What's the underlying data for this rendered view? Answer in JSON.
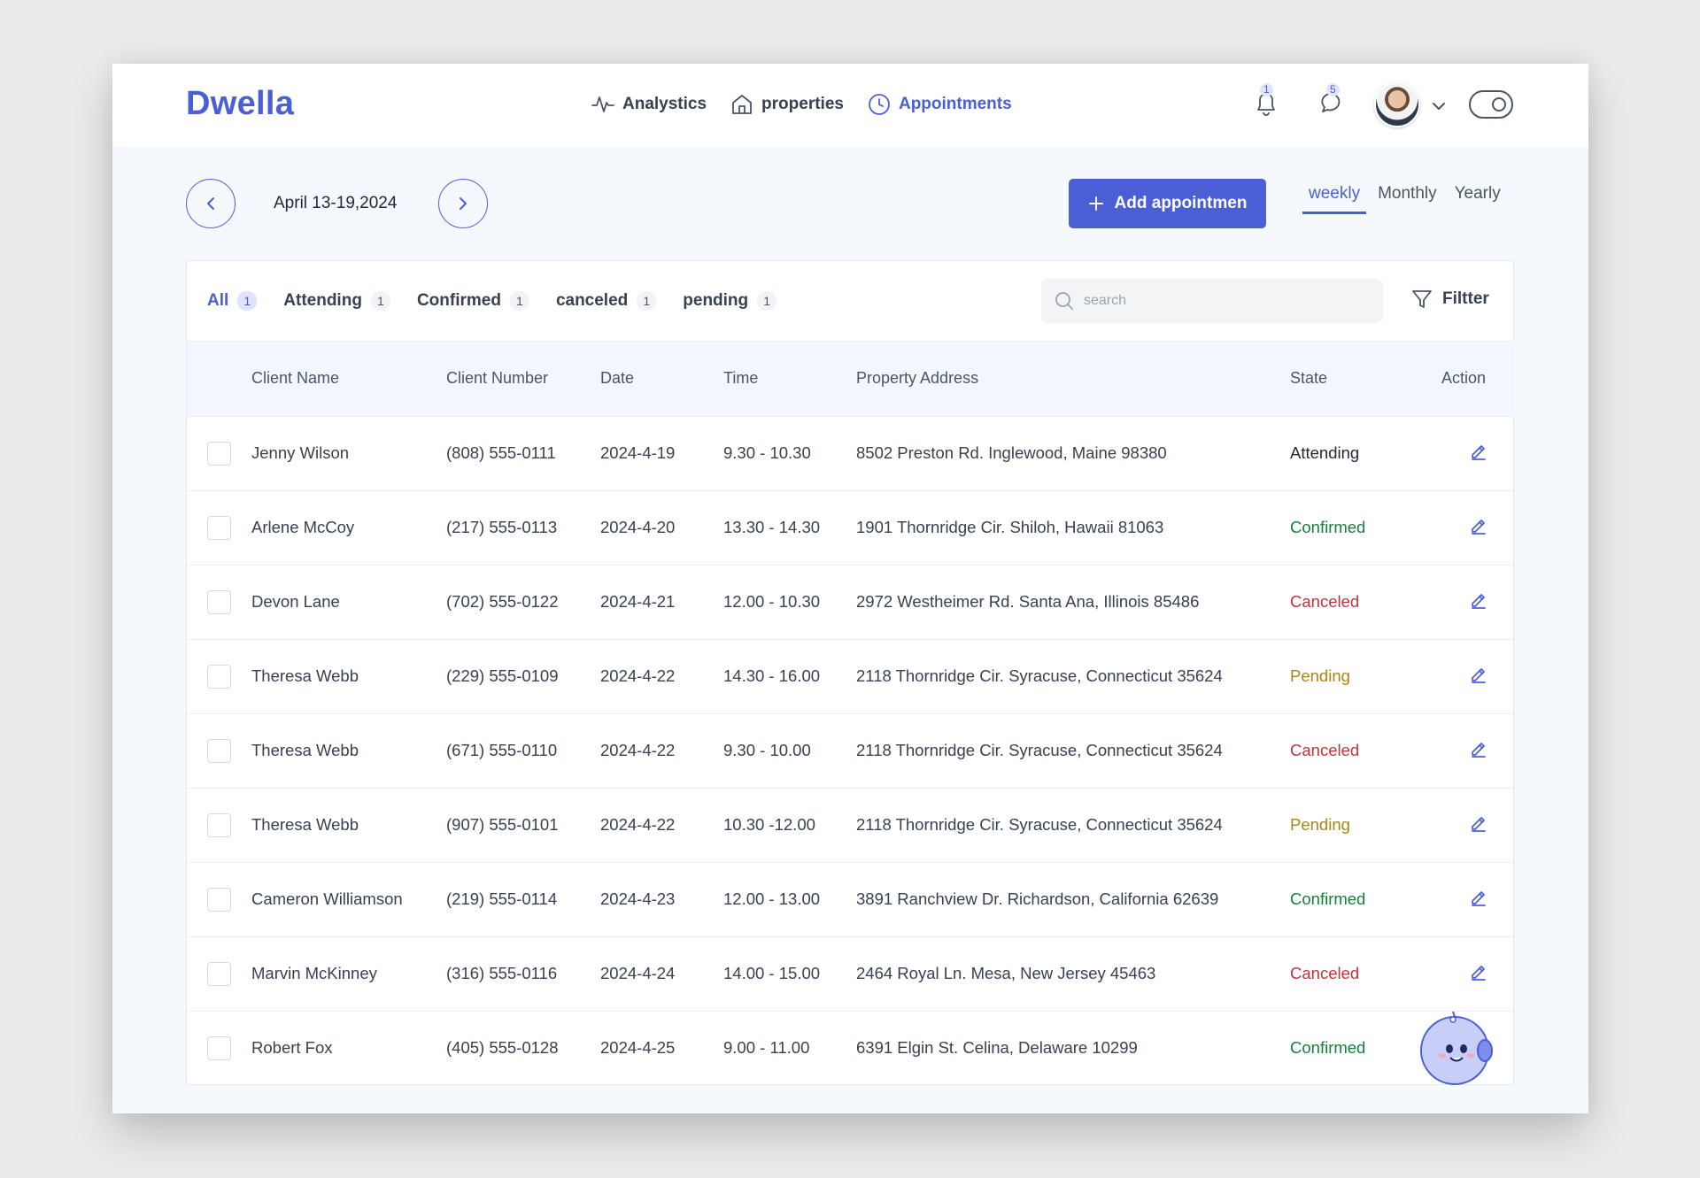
{
  "app": {
    "logo": "Dwella"
  },
  "nav": [
    {
      "label": "Analystics",
      "icon": "analytics-icon",
      "active": false
    },
    {
      "label": "properties",
      "icon": "home-icon",
      "active": false
    },
    {
      "label": "Appointments",
      "icon": "clock-icon",
      "active": true
    }
  ],
  "header": {
    "notifications_count": "1",
    "messages_count": "5",
    "accent_color": "#4a5fd6"
  },
  "toolbar": {
    "date_range": "April 13-19,2024",
    "add_button_label": "Add appointmen",
    "period_tabs": [
      {
        "label": "weekly",
        "active": true
      },
      {
        "label": "Monthly",
        "active": false
      },
      {
        "label": "Yearly",
        "active": false
      }
    ]
  },
  "filters": {
    "tabs": [
      {
        "label": "All",
        "count": "1",
        "active": true
      },
      {
        "label": "Attending",
        "count": "1",
        "active": false
      },
      {
        "label": "Confirmed",
        "count": "1",
        "active": false
      },
      {
        "label": "canceled",
        "count": "1",
        "active": false
      },
      {
        "label": "pending",
        "count": "1",
        "active": false
      }
    ],
    "search_placeholder": "search",
    "filter_label": "Filtter"
  },
  "table": {
    "columns": [
      "Client Name",
      "Client Number",
      "Date",
      "Time",
      "Property Address",
      "State",
      "Action"
    ],
    "rows": [
      {
        "name": "Jenny Wilson",
        "number": "(808) 555-0111",
        "date": "2024-4-19",
        "time": "9.30 - 10.30",
        "address": "8502 Preston Rd. Inglewood, Maine 98380",
        "state": "Attending"
      },
      {
        "name": "Arlene McCoy",
        "number": "(217) 555-0113",
        "date": "2024-4-20",
        "time": "13.30 - 14.30",
        "address": "1901 Thornridge Cir. Shiloh, Hawaii 81063",
        "state": "Confirmed"
      },
      {
        "name": "Devon Lane",
        "number": "(702) 555-0122",
        "date": "2024-4-21",
        "time": "12.00 - 10.30",
        "address": "2972 Westheimer Rd. Santa Ana, Illinois 85486",
        "state": "Canceled"
      },
      {
        "name": "Theresa Webb",
        "number": "(229) 555-0109",
        "date": "2024-4-22",
        "time": "14.30 - 16.00",
        "address": "2118 Thornridge Cir. Syracuse, Connecticut 35624",
        "state": "Pending"
      },
      {
        "name": "Theresa Webb",
        "number": "(671) 555-0110",
        "date": "2024-4-22",
        "time": "9.30 - 10.00",
        "address": "2118 Thornridge Cir. Syracuse, Connecticut 35624",
        "state": "Canceled"
      },
      {
        "name": "Theresa Webb",
        "number": "(907) 555-0101",
        "date": "2024-4-22",
        "time": "10.30 -12.00",
        "address": "2118 Thornridge Cir. Syracuse, Connecticut 35624",
        "state": "Pending"
      },
      {
        "name": "Cameron Williamson",
        "number": "(219) 555-0114",
        "date": "2024-4-23",
        "time": "12.00 - 13.00",
        "address": "3891 Ranchview Dr. Richardson, California 62639",
        "state": "Confirmed"
      },
      {
        "name": "Marvin McKinney",
        "number": "(316) 555-0116",
        "date": "2024-4-24",
        "time": "14.00 - 15.00",
        "address": "2464 Royal Ln. Mesa, New Jersey 45463",
        "state": "Canceled"
      },
      {
        "name": "Robert Fox",
        "number": "(405) 555-0128",
        "date": "2024-4-25",
        "time": "9.00 - 11.00",
        "address": "6391 Elgin St. Celina, Delaware 10299",
        "state": "Confirmed"
      }
    ]
  },
  "state_colors": {
    "Attending": "#1f2937",
    "Confirmed": "#15803d",
    "Canceled": "#c2333a",
    "Pending": "#a98517"
  }
}
